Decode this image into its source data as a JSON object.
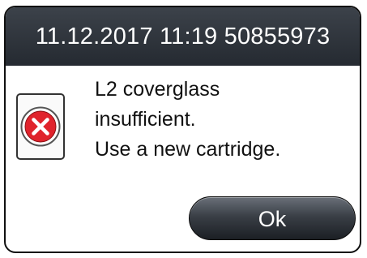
{
  "dialog": {
    "header": "11.12.2017 11:19 50855973",
    "icon": "error-icon",
    "message_lines": [
      "L2 coverglass",
      "insufficient.",
      "Use a new cartridge."
    ],
    "ok_label": "Ok"
  },
  "colors": {
    "header_bg": "#2f343b",
    "error_red": "#e0232c",
    "button_dark": "#2a2e34"
  }
}
